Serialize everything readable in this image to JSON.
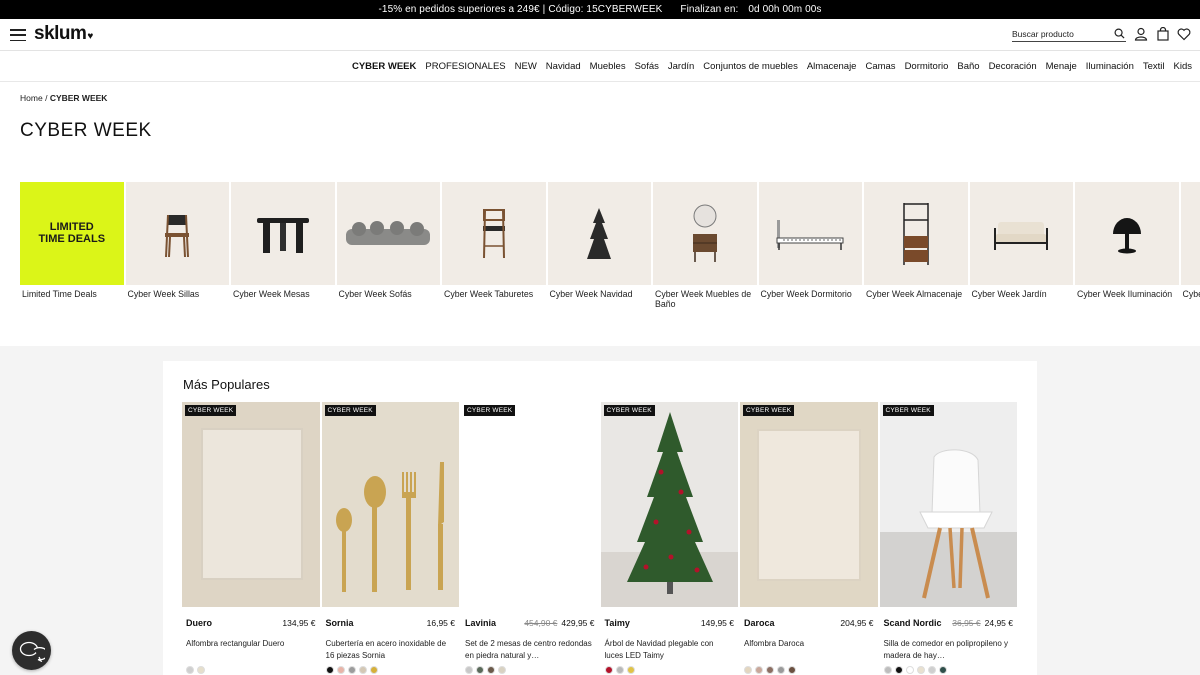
{
  "promo": {
    "text": "-15% en pedidos superiores a 249€",
    "code": "Código: 15CYBERWEEK",
    "countdown_label": "Finalizan en:",
    "countdown": "0d 00h 00m 00s"
  },
  "header": {
    "logo": "sklum",
    "search_placeholder": "Buscar producto"
  },
  "nav": [
    "CYBER WEEK",
    "PROFESIONALES",
    "NEW",
    "Navidad",
    "Muebles",
    "Sofás",
    "Jardín",
    "Conjuntos de muebles",
    "Almacenaje",
    "Camas",
    "Dormitorio",
    "Baño",
    "Decoración",
    "Menaje",
    "Iluminación",
    "Textil",
    "Kids"
  ],
  "breadcrumb": {
    "home": "Home",
    "sep": "/",
    "current": "CYBER WEEK"
  },
  "page_title": "CYBER WEEK",
  "limited": {
    "text": "LIMITED TIME DEALS"
  },
  "categories": [
    "Limited Time Deals",
    "Cyber Week Sillas",
    "Cyber Week Mesas",
    "Cyber Week Sofás",
    "Cyber Week Taburetes",
    "Cyber Week Navidad",
    "Cyber Week Muebles de Baño",
    "Cyber Week Dormitorio",
    "Cyber Week Almacenaje",
    "Cyber Week Jardín",
    "Cyber Week Iluminación",
    "Cyber Week Deco"
  ],
  "popular": {
    "title": "Más Populares",
    "badge": "CYBER WEEK",
    "products": [
      {
        "name": "Duero",
        "old_price": "",
        "price": "134,95 €",
        "desc": "Alfombra rectangular Duero",
        "swatches": [
          "#cfcfcf",
          "#e6dfcc"
        ]
      },
      {
        "name": "Sornia",
        "old_price": "",
        "price": "16,95 €",
        "desc": "Cubertería en acero inoxidable de 16 piezas Sornia",
        "swatches": [
          "#111111",
          "#e8b4a8",
          "#9c9c9c",
          "#d4c8b5",
          "#d6b03a"
        ]
      },
      {
        "name": "Lavinia",
        "old_price": "454,90 €",
        "price": "429,95 €",
        "desc": "Set de 2 mesas de centro redondas en piedra natural y…",
        "swatches": [
          "#c8c8c8",
          "#5a6a5a",
          "#6b5a4a",
          "#d9d2c2"
        ]
      },
      {
        "name": "Taimy",
        "old_price": "",
        "price": "149,95 €",
        "desc": "Árbol de Navidad plegable con luces LED Taimy",
        "swatches": [
          "#b3122a",
          "#b8b8b8",
          "#e0c347"
        ]
      },
      {
        "name": "Daroca",
        "old_price": "",
        "price": "204,95 €",
        "desc": "Alfombra Daroca",
        "swatches": [
          "#e3d6c0",
          "#c9a79a",
          "#8c6e62",
          "#9a9a9a",
          "#6b5040"
        ]
      },
      {
        "name": "Scand Nordic",
        "old_price": "36,95 €",
        "price": "24,95 €",
        "desc": "Silla de comedor en polipropileno y madera de hay…",
        "swatches": [
          "#bdbdbd",
          "#111111",
          "#ffffff",
          "#e9e1d0",
          "#cfcfcf",
          "#2f4f4a"
        ]
      }
    ]
  }
}
